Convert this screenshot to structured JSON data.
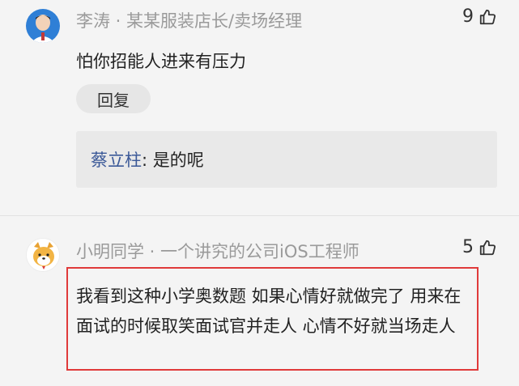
{
  "comments": [
    {
      "author": "李涛",
      "title": "某某服装店长/卖场经理",
      "likes": "9",
      "content": "怕你招能人进来有压力",
      "reply_label": "回复",
      "reply": {
        "author": "蔡立柱",
        "text": ": 是的呢"
      }
    },
    {
      "author": "小明同学",
      "title": "一个讲究的公司iOS工程师",
      "likes": "5",
      "content": "我看到这种小学奥数题 如果心情好就做完了 用来在面试的时候取笑面试官并走人 心情不好就当场走人"
    }
  ],
  "separator": " · ",
  "colors": {
    "highlight_border": "#e03a3a",
    "reply_name": "#3b5998",
    "meta_gray": "#9a9a9a"
  }
}
